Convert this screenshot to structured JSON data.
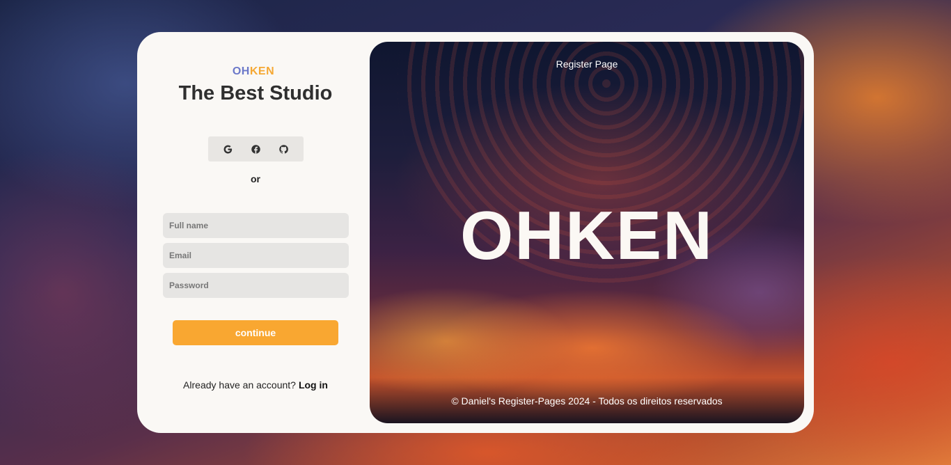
{
  "brand": {
    "part1": "OH",
    "part2": "KEN"
  },
  "title": "The Best Studio",
  "social": {
    "icons": [
      "google-icon",
      "facebook-icon",
      "github-icon"
    ]
  },
  "separator": "or",
  "form": {
    "full_name_placeholder": "Full name",
    "email_placeholder": "Email",
    "password_placeholder": "Password",
    "continue_label": "continue"
  },
  "footer": {
    "prompt": "Already have an account?",
    "login_label": "Log in"
  },
  "hero": {
    "page_label": "Register Page",
    "logo_text": "OHKEN",
    "copyright": "© Daniel's Register-Pages 2024 - Todos os direitos reservados"
  },
  "colors": {
    "accent": "#f9a731",
    "brand_blue": "#6b78c9",
    "brand_orange": "#f5a833",
    "card_bg": "#faf8f5"
  }
}
